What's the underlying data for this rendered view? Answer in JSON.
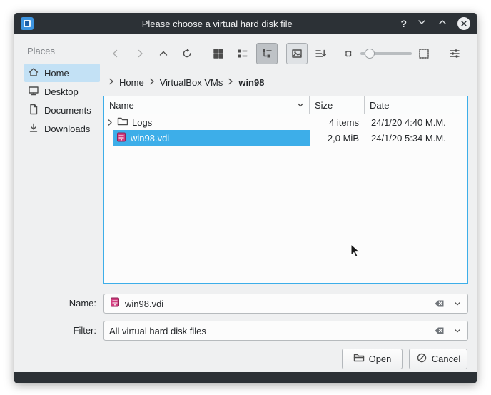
{
  "titlebar": {
    "title": "Please choose a virtual hard disk file",
    "help_label": "?"
  },
  "places": {
    "header": "Places",
    "items": [
      {
        "label": "Home",
        "selected": true
      },
      {
        "label": "Desktop",
        "selected": false
      },
      {
        "label": "Documents",
        "selected": false
      },
      {
        "label": "Downloads",
        "selected": false
      }
    ]
  },
  "toolbar": {
    "icons": [
      "go-back",
      "go-forward",
      "go-up",
      "view-refresh",
      "icon-view",
      "details-view",
      "tree-view",
      "preview",
      "sort",
      "zoom-out",
      "zoom-slider",
      "zoom-in",
      "options"
    ]
  },
  "breadcrumb": {
    "items": [
      "Home",
      "VirtualBox VMs",
      "win98"
    ]
  },
  "file_list": {
    "columns": [
      {
        "label": "Name",
        "sorted": true
      },
      {
        "label": "Size"
      },
      {
        "label": "Date"
      }
    ],
    "rows": [
      {
        "name": "Logs",
        "type": "folder",
        "size": "4 items",
        "date": "24/1/20 4:40 M.M.",
        "selected": false,
        "expandable": true
      },
      {
        "name": "win98.vdi",
        "type": "vdi-file",
        "size": "2,0 MiB",
        "date": "24/1/20 5:34 M.M.",
        "selected": true,
        "expandable": false
      }
    ]
  },
  "name_field": {
    "label": "Name:",
    "value": "win98.vdi"
  },
  "filter_field": {
    "label": "Filter:",
    "value": "All virtual hard disk files"
  },
  "buttons": {
    "open": "Open",
    "cancel": "Cancel"
  },
  "colors": {
    "selection": "#3daee9",
    "titlebar": "#2c3136",
    "window_bg": "#eff0f1",
    "view_bg": "#fcfcfc",
    "focus_border": "#3daee9",
    "sidebar_selected": "#c3e1f5"
  }
}
